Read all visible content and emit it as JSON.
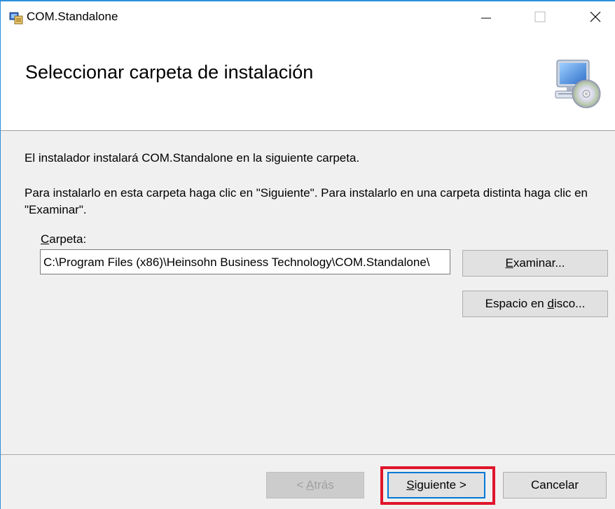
{
  "window": {
    "title": "COM.Standalone",
    "controls": {
      "minimize": "—",
      "maximize": "☐",
      "close": "✕"
    }
  },
  "header": {
    "title": "Seleccionar carpeta de instalación",
    "icon": "computer-cd-icon"
  },
  "body": {
    "line1": "El instalador instalará COM.Standalone en la siguiente carpeta.",
    "line2": "Para instalarlo en esta carpeta haga clic en \"Siguiente\". Para instalarlo en una carpeta distinta haga clic en \"Examinar\"."
  },
  "folder": {
    "label_mnemonic": "C",
    "label_rest": "arpeta:",
    "value": "C:\\Program Files (x86)\\Heinsohn Business Technology\\COM.Standalone\\"
  },
  "buttons": {
    "examinar": {
      "mnemonic": "E",
      "rest": "xaminar..."
    },
    "espacio": {
      "pre": "Espacio en ",
      "mnemonic": "d",
      "rest": "isco..."
    },
    "atras": {
      "pre": "< ",
      "mnemonic": "A",
      "rest": "trás"
    },
    "siguiente": {
      "mnemonic": "S",
      "rest": "iguiente >"
    },
    "cancelar": "Cancelar"
  },
  "colors": {
    "accent_border": "#2b8fdc",
    "highlight": "#e0162b",
    "focus": "#0078d7"
  }
}
